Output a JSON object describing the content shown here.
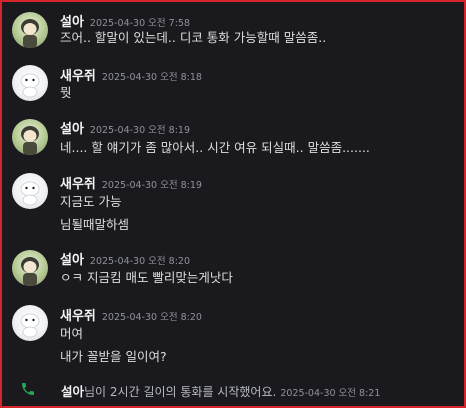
{
  "messages": [
    {
      "author": "설아",
      "time": "2025-04-30 오전 7:58",
      "lines": [
        "즈어.. 할말이 있는데.. 디코 통화 가능할때 말씀좀.."
      ]
    },
    {
      "author": "새우쥐",
      "time": "2025-04-30 오전 8:18",
      "lines": [
        "뭣"
      ]
    },
    {
      "author": "설아",
      "time": "2025-04-30 오전 8:19",
      "lines": [
        "네.... 할 얘기가 좀 많아서.. 시간 여유 되실때.. 말씀좀......."
      ]
    },
    {
      "author": "새우쥐",
      "time": "2025-04-30 오전 8:19",
      "lines": [
        "지금도 가능",
        "님될때말하셈"
      ]
    },
    {
      "author": "설아",
      "time": "2025-04-30 오전 8:20",
      "lines": [
        "ㅇㅋ 지금킴 매도 빨리맞는게낫다"
      ]
    },
    {
      "author": "새우쥐",
      "time": "2025-04-30 오전 8:20",
      "lines": [
        "머여",
        "내가 꼴받을 일이여?"
      ]
    }
  ],
  "system_call": {
    "author": "설아",
    "text": "님이 2시간 길이의 통화를 시작했어요.",
    "time": "2025-04-30 오전 8:21",
    "icon": "phone-icon",
    "icon_color": "#23a55a"
  },
  "colors": {
    "background": "#1a1a1e",
    "border": "#d3252b",
    "text": "#dbdee1",
    "muted": "#8e9297"
  }
}
